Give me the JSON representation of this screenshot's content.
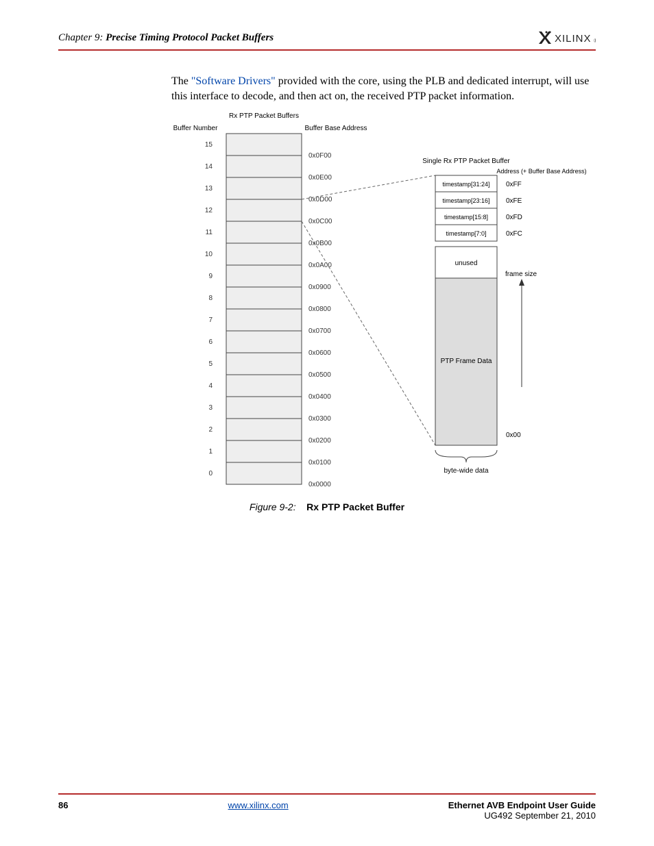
{
  "header": {
    "chapter_prefix": "Chapter 9:",
    "chapter_title": "Precise Timing Protocol Packet Buffers",
    "logo_text": "XILINX"
  },
  "body": {
    "text_prefix": "The ",
    "link_text": "\"Software Drivers\"",
    "text_suffix": " provided with the core, using the PLB and dedicated interrupt, will use this interface to decode, and then act on, the received PTP packet information."
  },
  "figure": {
    "title_top": "Rx PTP Packet Buffers",
    "label_buffer_number": "Buffer Number",
    "label_buffer_base": "Buffer Base Address",
    "rows": [
      {
        "num": "15",
        "addr": "0x0F00"
      },
      {
        "num": "14",
        "addr": "0x0E00"
      },
      {
        "num": "13",
        "addr": "0x0D00"
      },
      {
        "num": "12",
        "addr": "0x0C00"
      },
      {
        "num": "11",
        "addr": "0x0B00"
      },
      {
        "num": "10",
        "addr": "0x0A00"
      },
      {
        "num": "9",
        "addr": "0x0900"
      },
      {
        "num": "8",
        "addr": "0x0800"
      },
      {
        "num": "7",
        "addr": "0x0700"
      },
      {
        "num": "6",
        "addr": "0x0600"
      },
      {
        "num": "5",
        "addr": "0x0500"
      },
      {
        "num": "4",
        "addr": "0x0400"
      },
      {
        "num": "3",
        "addr": "0x0300"
      },
      {
        "num": "2",
        "addr": "0x0200"
      },
      {
        "num": "1",
        "addr": "0x0100"
      },
      {
        "num": "0",
        "addr": "0x0000"
      }
    ],
    "single_buffer_title": "Single Rx PTP Packet Buffer",
    "addr_offset_label": "Address (+ Buffer Base Address)",
    "ts_rows": [
      {
        "label": "timestamp[31:24]",
        "addr": "0xFF"
      },
      {
        "label": "timestamp[23:16]",
        "addr": "0xFE"
      },
      {
        "label": "timestamp[15:8]",
        "addr": "0xFD"
      },
      {
        "label": "timestamp[7:0]",
        "addr": "0xFC"
      }
    ],
    "unused_label": "unused",
    "frame_size_label": "frame size",
    "ptp_data_label": "PTP Frame Data",
    "addr_zero": "0x00",
    "byte_wide_label": "byte-wide data",
    "caption_num": "Figure 9-2:",
    "caption_title": "Rx PTP Packet Buffer"
  },
  "footer": {
    "page_num": "86",
    "url": "www.xilinx.com",
    "doc_name": "Ethernet AVB Endpoint User Guide",
    "doc_rev": "UG492 September 21, 2010"
  }
}
